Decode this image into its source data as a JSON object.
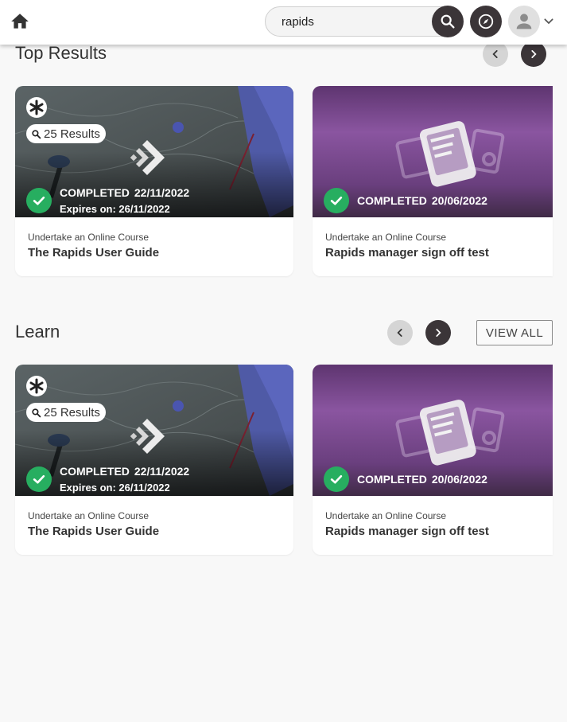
{
  "header": {
    "home_icon": "home-icon",
    "search_value": "rapids",
    "search_icon": "search-icon",
    "explore_icon": "compass-icon",
    "avatar_icon": "person-icon",
    "menu_icon": "chevron-down-icon"
  },
  "sections": [
    {
      "title": "Top Results",
      "cards": [
        {
          "type": "Undertake an Online Course",
          "title": "The Rapids User Guide",
          "results": "25 Results",
          "status": "COMPLETED",
          "date": "22/11/2022",
          "expires": "Expires on: 26/11/2022",
          "theme": "photo"
        },
        {
          "type": "Undertake an Online Course",
          "title": "Rapids manager sign off test",
          "status": "COMPLETED",
          "date": "20/06/2022",
          "theme": "purple"
        }
      ]
    },
    {
      "title": "Learn",
      "view_all": "VIEW ALL",
      "cards": [
        {
          "type": "Undertake an Online Course",
          "title": "The Rapids User Guide",
          "results": "25 Results",
          "status": "COMPLETED",
          "date": "22/11/2022",
          "expires": "Expires on: 26/11/2022",
          "theme": "photo"
        },
        {
          "type": "Undertake an Online Course",
          "title": "Rapids manager sign off test",
          "status": "COMPLETED",
          "date": "20/06/2022",
          "theme": "purple"
        }
      ]
    }
  ],
  "colors": {
    "completed_green": "#27ae60",
    "dark_button": "#3b3538",
    "purple_card": "#7a4a8c"
  }
}
